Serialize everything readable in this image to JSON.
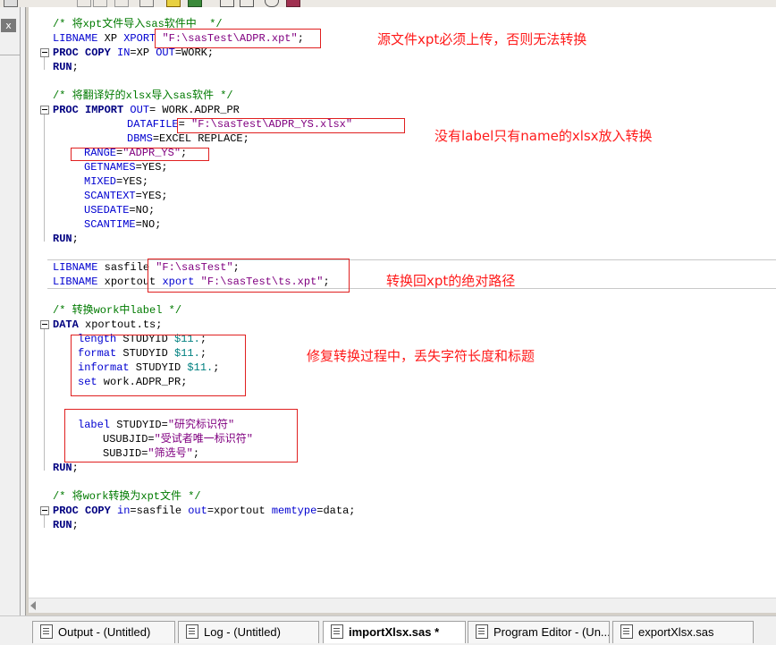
{
  "code": {
    "l1_comment": "/* 将xpt文件导入sas软件中  */",
    "l2_kw": "LIBNAME",
    "l2_mid": " XP ",
    "l2_xport": "XPORT",
    "l2_str": " \"F:\\sasTest\\ADPR.xpt\"",
    "l2_end": ";",
    "l3_kw": "PROC COPY",
    "l3_in": " IN",
    "l3_rest": "=XP ",
    "l3_out": "OUT",
    "l3_end": "=WORK;",
    "l4_kw": "RUN",
    "l4_end": ";",
    "l6_comment": "/* 将翻译好的xlsx导入sas软件 */",
    "l7_kw": "PROC IMPORT",
    "l7_out": " OUT",
    "l7_rest": "= WORK.ADPR_PR",
    "l8_opt": "DATAFILE",
    "l8_eq": "=",
    "l8_str": " \"F:\\sasTest\\ADPR_YS.xlsx\"",
    "l9_opt": "DBMS",
    "l9_rest": "=EXCEL REPLACE;",
    "l10_opt": "RANGE",
    "l10_eq": "=",
    "l10_str": "\"ADPR_YS\"",
    "l10_end": ";",
    "l11_opt": "GETNAMES",
    "l11_rest": "=YES;",
    "l12_opt": "MIXED",
    "l12_rest": "=YES;",
    "l13_opt": "SCANTEXT",
    "l13_rest": "=YES;",
    "l14_opt": "USEDATE",
    "l14_rest": "=NO;",
    "l15_opt": "SCANTIME",
    "l15_rest": "=NO;",
    "l16_kw": "RUN",
    "l16_end": ";",
    "l18_kw": "LIBNAME",
    "l18_mid": " sasfile ",
    "l18_str": "\"F:\\sasTest\"",
    "l18_end": ";",
    "l19_kw": "LIBNAME",
    "l19_mid": " xportout ",
    "l19_xport": "xport",
    "l19_str": " \"F:\\sasTest\\ts.xpt\"",
    "l19_end": ";",
    "l21_comment": "/* 转换work中label */",
    "l22_kw": "DATA",
    "l22_rest": " xportout.ts;",
    "l23_kw": "length",
    "l23_mid": " STUDYID ",
    "l23_fmt": "$11.",
    "l23_end": ";",
    "l24_kw": "format",
    "l24_mid": " STUDYID ",
    "l24_fmt": "$11.",
    "l24_end": ";",
    "l25_kw": "informat",
    "l25_mid": " STUDYID ",
    "l25_fmt": "$11.",
    "l25_end": ";",
    "l26_kw": "set",
    "l26_rest": " work.ADPR_PR;",
    "l29_kw": "label",
    "l29_mid": " STUDYID=",
    "l29_str": "\"研究标识符\"",
    "l30_mid": "USUBJID=",
    "l30_str": "\"受试者唯一标识符\"",
    "l31_mid": "SUBJID=",
    "l31_str": "\"筛选号\"",
    "l31_end": ";",
    "l32_kw": "RUN",
    "l32_end": ";",
    "l34_comment": "/* 将work转换为xpt文件 */",
    "l35_kw": "PROC COPY",
    "l35_in": " in",
    "l35_mid": "=sasfile ",
    "l35_out": "out",
    "l35_mid2": "=xportout ",
    "l35_mem": "memtype",
    "l35_end": "=data;",
    "l36_kw": "RUN",
    "l36_end": ";"
  },
  "annotations": {
    "note1": "源文件xpt必须上传，否则无法转换",
    "note2": "没有label只有name的xlsx放入转换",
    "note3": "转换回xpt的绝对路径",
    "note4": "修复转换过程中，丢失字符长度和标题"
  },
  "sidebar": {
    "close_label": "x"
  },
  "taskbar": {
    "tabs": [
      {
        "label": "Output - (Untitled)"
      },
      {
        "label": "Log - (Untitled)"
      },
      {
        "label": "importXlsx.sas *"
      },
      {
        "label": "Program Editor - (Un..."
      },
      {
        "label": "exportXlsx.sas"
      }
    ]
  },
  "colors": {
    "comment": "#007a00",
    "keyword": "#000080",
    "option": "#0000d0",
    "string": "#800080",
    "format": "#008080",
    "annotation": "#ff1a1a"
  }
}
